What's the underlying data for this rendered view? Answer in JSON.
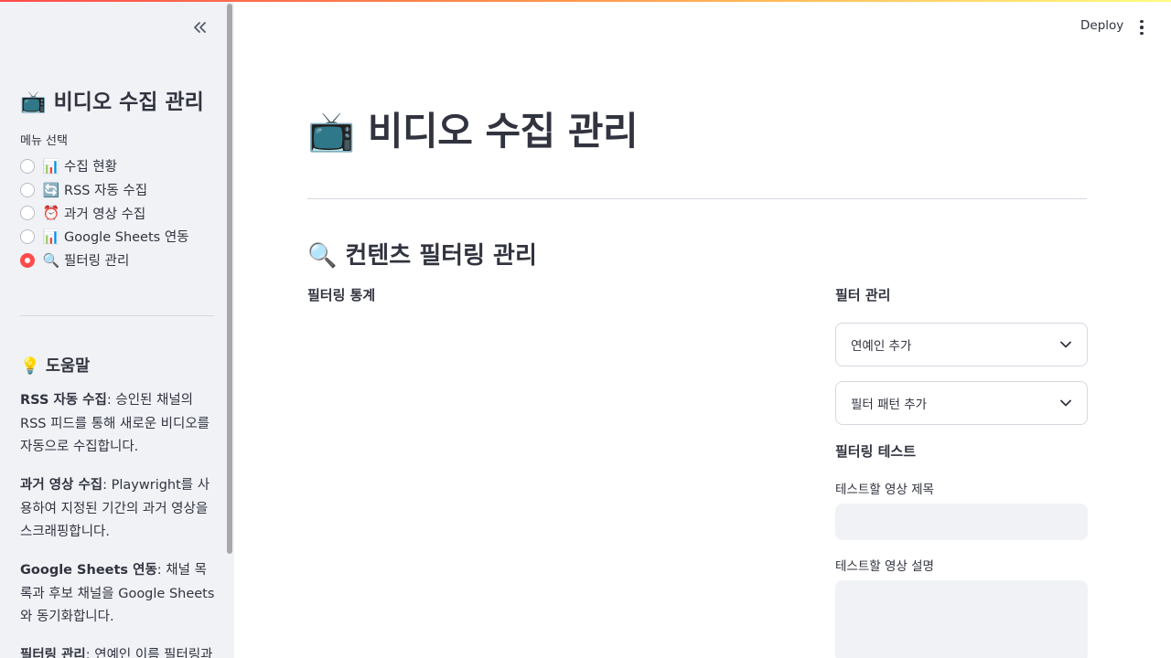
{
  "header": {
    "deploy_label": "Deploy"
  },
  "sidebar": {
    "title": "📺 비디오 수집 관리",
    "menu_label": "메뉴 선택",
    "menu_items": [
      {
        "icon": "📊",
        "label": "수집 현황",
        "checked": false
      },
      {
        "icon": "🔄",
        "label": "RSS 자동 수집",
        "checked": false
      },
      {
        "icon": "⏰",
        "label": "과거 영상 수집",
        "checked": false
      },
      {
        "icon": "📊",
        "label": "Google Sheets 연동",
        "checked": false
      },
      {
        "icon": "🔍",
        "label": "필터링 관리",
        "checked": true
      }
    ],
    "help_title": "💡 도움말",
    "help": [
      {
        "term": "RSS 자동 수집",
        "desc": ": 승인된 채널의 RSS 피드를 통해 새로운 비디오를 자동으로 수집합니다."
      },
      {
        "term": "과거 영상 수집",
        "desc": ": Playwright를 사용하여 지정된 기간의 과거 영상을 스크래핑합니다."
      },
      {
        "term": "Google Sheets 연동",
        "desc": ": 채널 목록과 후보 채널을 Google Sheets와 동기화합니다."
      },
      {
        "term": "필터링 관리",
        "desc": ": 연예인 이름 필터링과"
      }
    ]
  },
  "main": {
    "title": "📺 비디오 수집 관리",
    "section_title": "🔍 컨텐츠 필터링 관리",
    "stats_label": "필터링 통계",
    "filter_mgmt_label": "필터 관리",
    "expanders": [
      "연예인 추가",
      "필터 패턴 추가"
    ],
    "test_label": "필터링 테스트",
    "title_field_label": "테스트할 영상 제목",
    "title_field_value": "",
    "desc_field_label": "테스트할 영상 설명",
    "desc_field_value": ""
  },
  "colors": {
    "accent": "#ff4b4b",
    "sidebar_bg": "#f0f2f6",
    "text": "#31333f"
  }
}
